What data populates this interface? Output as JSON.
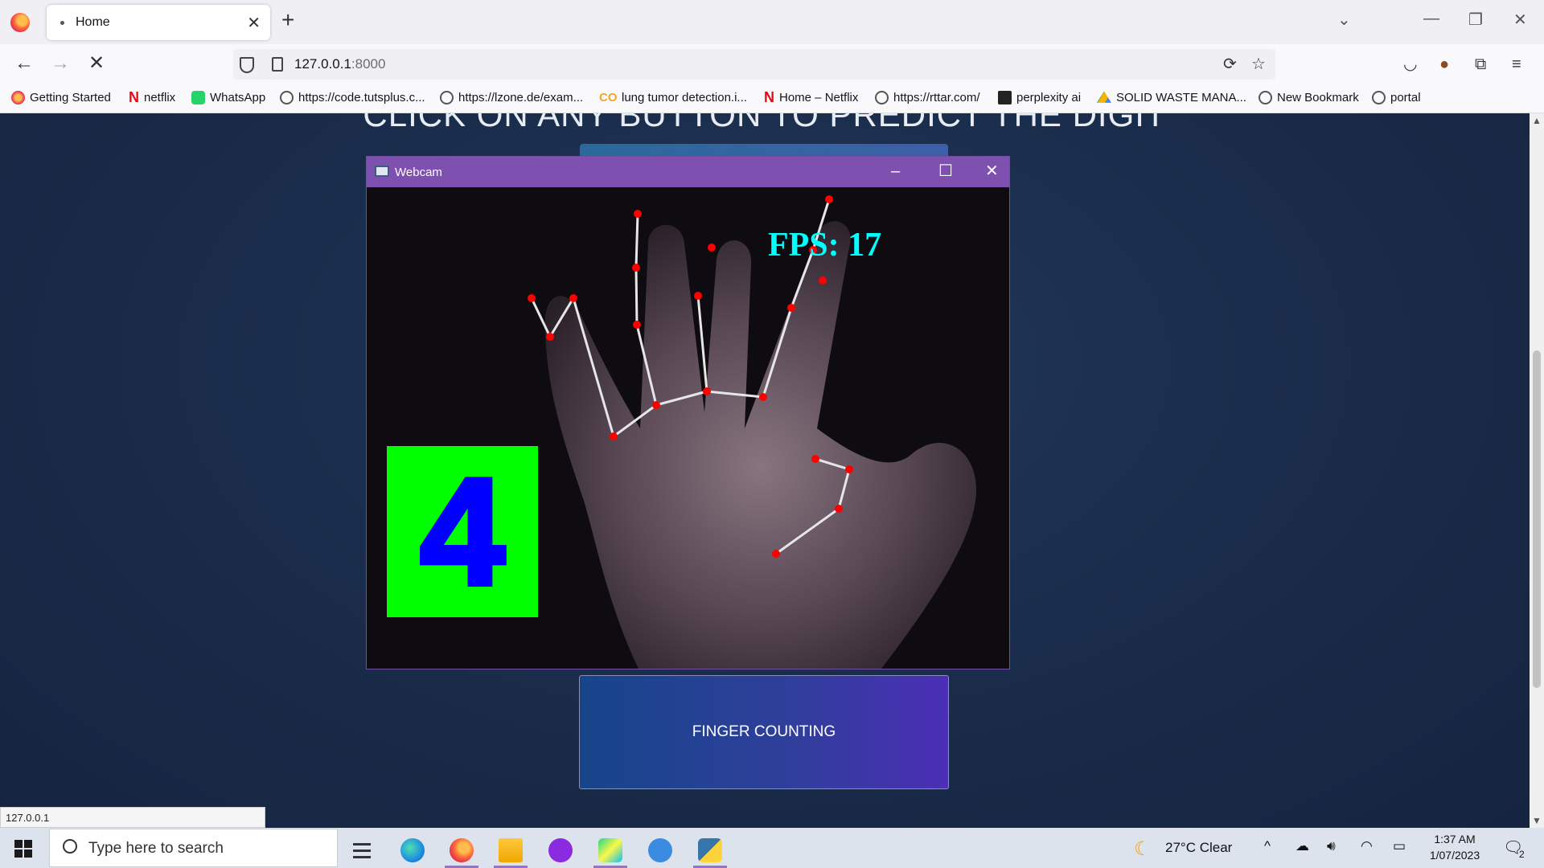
{
  "browser": {
    "tab_title": "Home",
    "url_host": "127.0.0.1",
    "url_port": ":8000",
    "bookmarks": [
      {
        "label": "Getting Started",
        "icon": "firefox-icon"
      },
      {
        "label": "netflix",
        "icon": "netflix-icon"
      },
      {
        "label": "WhatsApp",
        "icon": "whatsapp-icon"
      },
      {
        "label": "https://code.tutsplus.c...",
        "icon": "globe-icon"
      },
      {
        "label": "https://lzone.de/exam...",
        "icon": "globe-icon"
      },
      {
        "label": "lung tumor detection.i...",
        "icon": "colab-icon"
      },
      {
        "label": "Home – Netflix",
        "icon": "netflix-icon"
      },
      {
        "label": "https://rttar.com/",
        "icon": "globe-icon"
      },
      {
        "label": "perplexity ai",
        "icon": "grid-icon"
      },
      {
        "label": "SOLID WASTE MANA...",
        "icon": "drive-icon"
      },
      {
        "label": "New Bookmark",
        "icon": "globe-icon"
      },
      {
        "label": "portal",
        "icon": "globe-icon"
      }
    ],
    "status_url": "127.0.0.1"
  },
  "page": {
    "heading": "CLICK ON ANY BUTTON TO PREDICT THE DIGIT",
    "finger_button_label": "FINGER COUNTING"
  },
  "webcam": {
    "window_title": "Webcam",
    "fps_text": "FPS:  17",
    "finger_count": "4",
    "colors": {
      "landmark": "#ff0000",
      "connection": "#e6e6e6",
      "count_box": "#00ff00",
      "count_digit": "#0000ff",
      "fps": "#00ffff",
      "titlebar": "#7e50b0"
    }
  },
  "taskbar": {
    "search_placeholder": "Type here to search",
    "weather": "27°C  Clear",
    "time": "1:37 AM",
    "date": "1/07/2023",
    "notification_count": "2"
  }
}
